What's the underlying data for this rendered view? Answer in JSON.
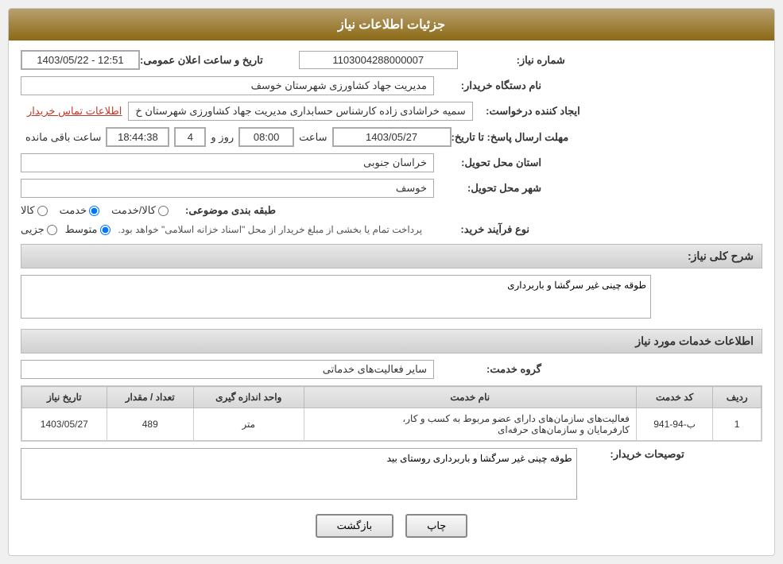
{
  "header": {
    "title": "جزئیات اطلاعات نیاز"
  },
  "fields": {
    "need_number_label": "شماره نیاز:",
    "need_number_value": "1103004288000007",
    "buyer_dept_label": "نام دستگاه خریدار:",
    "buyer_dept_value": "مدیریت جهاد کشاورزی شهرستان خوسف",
    "creator_label": "ایجاد کننده درخواست:",
    "creator_value": "سمیه خراشادی زاده کارشناس حسابداری مدیریت جهاد کشاورزی شهرستان خ",
    "creator_link": "اطلاعات تماس خریدار",
    "send_date_label": "مهلت ارسال پاسخ: تا تاریخ:",
    "send_date_date": "1403/05/27",
    "send_date_time_label": "ساعت",
    "send_date_time": "08:00",
    "send_date_day_label": "روز و",
    "send_date_days": "4",
    "send_date_remaining_label": "ساعت باقی مانده",
    "send_date_remaining": "18:44:38",
    "announce_date_label": "تاریخ و ساعت اعلان عمومی:",
    "announce_date_value": "1403/05/22 - 12:51",
    "province_label": "استان محل تحویل:",
    "province_value": "خراسان جنوبی",
    "city_label": "شهر محل تحویل:",
    "city_value": "خوسف",
    "category_label": "طبقه بندی موضوعی:",
    "category_options": [
      "کالا",
      "خدمت",
      "کالا/خدمت"
    ],
    "category_selected": "خدمت",
    "purchase_type_label": "نوع فرآیند خرید:",
    "purchase_type_options": [
      "جزیی",
      "متوسط"
    ],
    "purchase_type_selected": "متوسط",
    "purchase_type_note": "پرداخت تمام یا بخشی از مبلغ خریدار از محل \"اسناد خزانه اسلامی\" خواهد بود.",
    "need_desc_label": "شرح کلی نیاز:",
    "need_desc_value": "طوقه چینی غیر سرگشا و باربرداری",
    "service_info_header": "اطلاعات خدمات مورد نیاز",
    "service_group_label": "گروه خدمت:",
    "service_group_value": "سایر فعالیت‌های خدماتی",
    "table": {
      "columns": [
        "ردیف",
        "کد خدمت",
        "نام خدمت",
        "واحد اندازه گیری",
        "تعداد / مقدار",
        "تاریخ نیاز"
      ],
      "rows": [
        {
          "row": "1",
          "code": "ب-94-941",
          "name": "فعالیت‌های سازمان‌های دارای عضو مربوط به کسب و کار، کارفرمایان و سازمان‌های حرفه‌ای",
          "unit": "متر",
          "quantity": "489",
          "date": "1403/05/27"
        }
      ]
    },
    "buyer_notes_label": "توصیحات خریدار:",
    "buyer_notes_value": "طوقه چینی غیر سرگشا و باربرداری روستای بید",
    "btn_print": "چاپ",
    "btn_back": "بازگشت"
  }
}
